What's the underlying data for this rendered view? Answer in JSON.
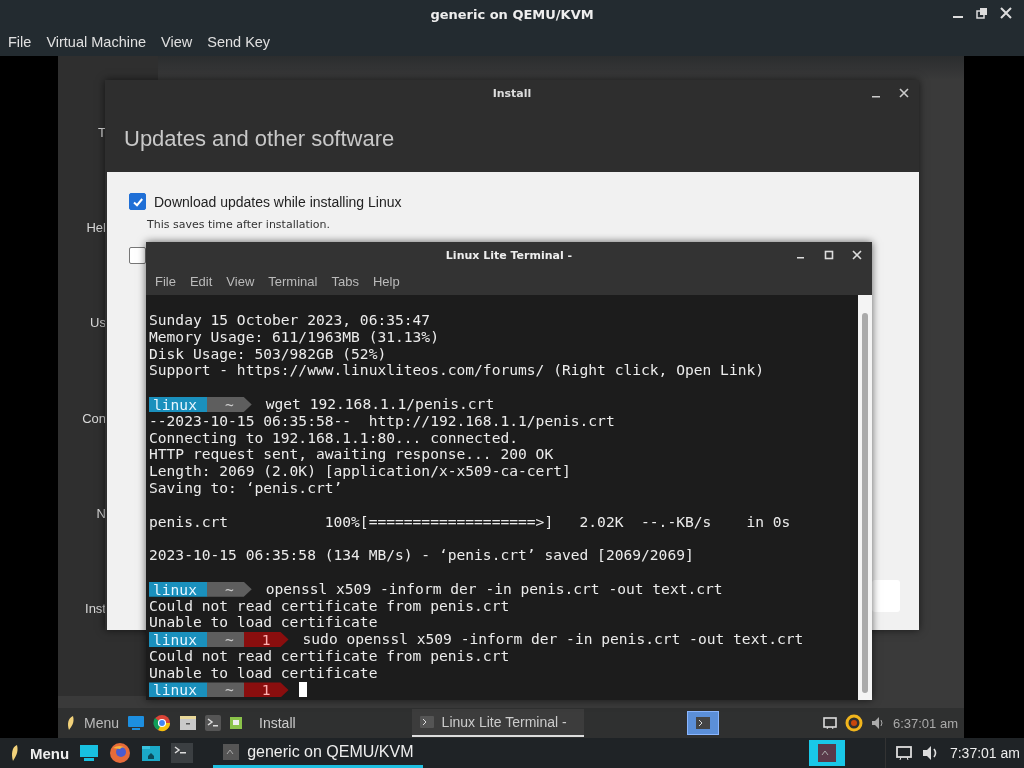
{
  "host_window": {
    "title": "generic on QEMU/KVM",
    "menu": [
      "File",
      "Virtual Machine",
      "View",
      "Send Key"
    ]
  },
  "background_window": {
    "fragments": [
      "T",
      "Hel",
      "Us",
      "Con",
      "N",
      "Inst"
    ]
  },
  "install_window": {
    "title": "Install",
    "heading": "Updates and other software",
    "options": [
      {
        "label": "Download updates while installing Linux",
        "description": "This saves time after installation.",
        "checked": true
      },
      {
        "checked": false
      }
    ]
  },
  "terminal": {
    "title": "Linux Lite Terminal -",
    "menu": [
      "File",
      "Edit",
      "View",
      "Terminal",
      "Tabs",
      "Help"
    ],
    "lines": [
      {
        "kind": "text",
        "text": "Sunday 15 October 2023, 06:35:47"
      },
      {
        "kind": "text",
        "text": "Memory Usage: 611/1963MB (31.13%)"
      },
      {
        "kind": "text",
        "text": "Disk Usage: 503/982GB (52%)"
      },
      {
        "kind": "text",
        "text": "Support - https://www.linuxliteos.com/forums/ (Right click, Open Link)"
      },
      {
        "kind": "blank"
      },
      {
        "kind": "prompt",
        "user": "linux",
        "dir": "~",
        "command": "wget 192.168.1.1/penis.crt"
      },
      {
        "kind": "text",
        "text": "--2023-10-15 06:35:58--  http://192.168.1.1/penis.crt"
      },
      {
        "kind": "text",
        "text": "Connecting to 192.168.1.1:80... connected."
      },
      {
        "kind": "text",
        "text": "HTTP request sent, awaiting response... 200 OK"
      },
      {
        "kind": "text",
        "text": "Length: 2069 (2.0K) [application/x-x509-ca-cert]"
      },
      {
        "kind": "text",
        "text": "Saving to: ‘penis.crt’"
      },
      {
        "kind": "blank"
      },
      {
        "kind": "text",
        "text": "penis.crt           100%[===================>]   2.02K  --.-KB/s    in 0s"
      },
      {
        "kind": "blank"
      },
      {
        "kind": "text",
        "text": "2023-10-15 06:35:58 (134 MB/s) - ‘penis.crt’ saved [2069/2069]"
      },
      {
        "kind": "blank"
      },
      {
        "kind": "prompt",
        "user": "linux",
        "dir": "~",
        "command": "openssl x509 -inform der -in penis.crt -out text.crt"
      },
      {
        "kind": "text",
        "text": "Could not read certificate from penis.crt"
      },
      {
        "kind": "text",
        "text": "Unable to load certificate"
      },
      {
        "kind": "prompt",
        "user": "linux",
        "dir": "~",
        "status": "1",
        "command": "sudo openssl x509 -inform der -in penis.crt -out text.crt"
      },
      {
        "kind": "text",
        "text": "Could not read certificate from penis.crt"
      },
      {
        "kind": "text",
        "text": "Unable to load certificate"
      },
      {
        "kind": "prompt",
        "user": "linux",
        "dir": "~",
        "status": "1",
        "cursor": true
      }
    ]
  },
  "guest_taskbar": {
    "menu_label": "Menu",
    "tasks": [
      {
        "label": "Install",
        "selected": false
      },
      {
        "label": "Linux Lite Terminal -",
        "selected": true
      }
    ],
    "clock": "6:37:01 am"
  },
  "host_taskbar": {
    "menu_label": "Menu",
    "tasks": [
      {
        "label": "generic on QEMU/KVM",
        "selected": true
      }
    ],
    "clock": "7:37:01 am"
  }
}
